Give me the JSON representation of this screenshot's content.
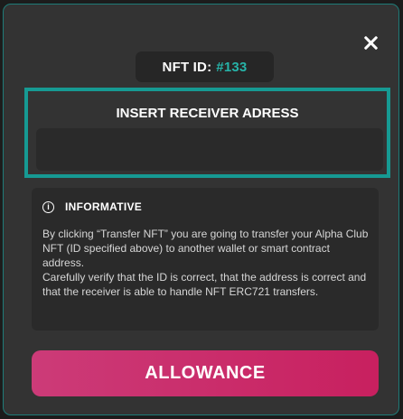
{
  "modal": {
    "close_icon": "close-icon",
    "accent_color": "#26b3a8",
    "border_color": "#169a93",
    "button_color": "#c8205f"
  },
  "nft": {
    "label": "NFT ID:",
    "id": "#133"
  },
  "receiver": {
    "label": "INSERT RECEIVER ADRESS",
    "value": "",
    "placeholder": ""
  },
  "info": {
    "icon": "info-icon",
    "title": "INFORMATIVE",
    "paragraph_1": "By clicking “Transfer NFT” you are going to transfer your Alpha Club NFT (ID specified above) to another wallet or smart contract address.",
    "paragraph_2": "Carefully verify that the ID is correct, that the address is correct and that the receiver is able to handle NFT ERC721 transfers."
  },
  "actions": {
    "allowance_label": "ALLOWANCE"
  }
}
